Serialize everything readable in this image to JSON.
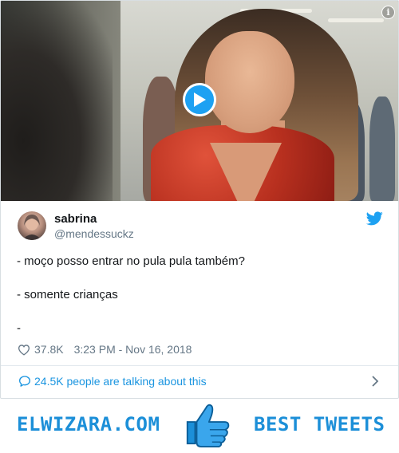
{
  "tweet": {
    "display_name": "sabrina",
    "handle": "@mendessuckz",
    "text_lines": [
      "- moço posso entrar no pula pula também?",
      "- somente crianças",
      "-"
    ],
    "likes": "37.8K",
    "timestamp": "3:23 PM - Nov 16, 2018",
    "talking": "24.5K people are talking about this"
  },
  "media": {
    "info_glyph": "i"
  },
  "footer": {
    "brand": "ELWIZARA.COM",
    "tagline": "BEST TWEETS"
  },
  "colors": {
    "accent": "#1da1f2",
    "link": "#1b95e0",
    "muted": "#657786",
    "brand": "#1c8fd8"
  },
  "icons": [
    "info-icon",
    "play-icon",
    "twitter-bird-icon",
    "heart-icon",
    "speech-bubble-icon",
    "chevron-right-icon",
    "thumbs-up-icon"
  ]
}
